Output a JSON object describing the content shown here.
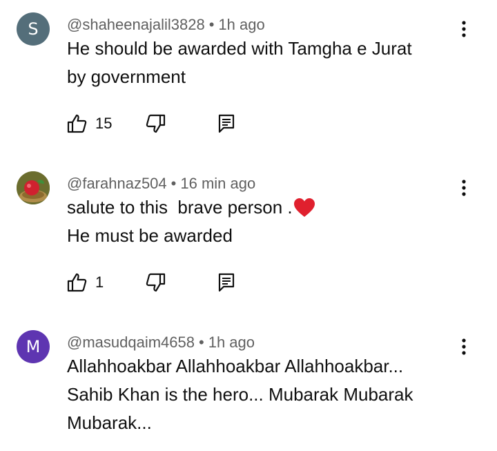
{
  "comments": [
    {
      "avatar_letter": "S",
      "avatar_color": "#546e7a",
      "username": "@shaheenajalil3828",
      "separator": "•",
      "time": "1h ago",
      "lines": [
        "He should be awarded with Tamgha e Jurat",
        "by government"
      ],
      "likes": "15"
    },
    {
      "avatar_letter": "",
      "avatar_color": "#8a8a3a",
      "username": "@farahnaz504",
      "separator": "•",
      "time": "16 min ago",
      "lines": [
        "salute to this  brave person .",
        "He must be awarded"
      ],
      "likes": "1"
    },
    {
      "avatar_letter": "M",
      "avatar_color": "#5e35b1",
      "username": "@masudqaim4658",
      "separator": "•",
      "time": "1h ago",
      "lines": [
        "Allahhoakbar Allahhoakbar Allahhoakbar...",
        "Sahib Khan is the hero... Mubarak Mubarak",
        "Mubarak..."
      ]
    }
  ],
  "icons": {
    "like": "thumbs-up-icon",
    "dislike": "thumbs-down-icon",
    "reply": "reply-icon",
    "more": "more-vert-icon",
    "emoji": "red-heart-emoji"
  },
  "colors": {
    "meta": "#606060",
    "text": "#0f0f0f",
    "heart": "#e0202e"
  }
}
